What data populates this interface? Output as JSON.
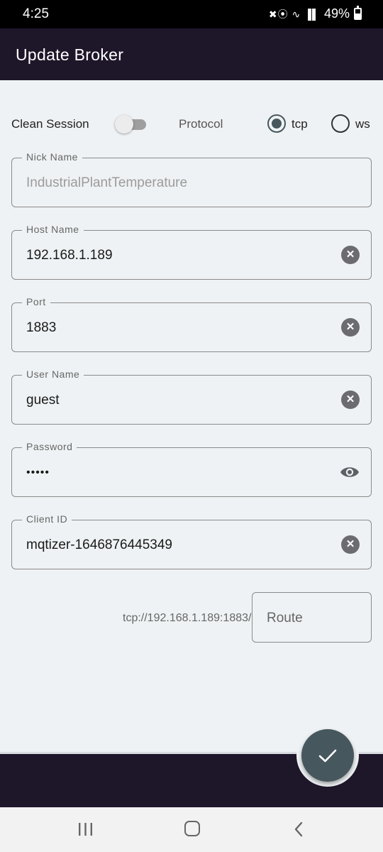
{
  "status_bar": {
    "time": "4:25",
    "battery": "49%",
    "signal_icons": "✖⦿ ∿ ▐▌"
  },
  "app_bar": {
    "title": "Update Broker"
  },
  "options": {
    "clean_session_label": "Clean Session",
    "clean_session_on": false,
    "protocol_label": "Protocol",
    "protocol_options": [
      {
        "label": "tcp",
        "selected": true
      },
      {
        "label": "ws",
        "selected": false
      }
    ]
  },
  "fields": {
    "nick_name": {
      "label": "Nick Name",
      "placeholder": "IndustrialPlantTemperature"
    },
    "host_name": {
      "label": "Host Name",
      "value": "192.168.1.189"
    },
    "port": {
      "label": "Port",
      "value": "1883"
    },
    "user_name": {
      "label": "User Name",
      "value": "guest"
    },
    "password": {
      "label": "Password",
      "value": "•••••"
    },
    "client_id": {
      "label": "Client ID",
      "value": "mqtizer-1646876445349"
    }
  },
  "route": {
    "prefix": "tcp://192.168.1.189:1883/",
    "placeholder": "Route"
  },
  "colors": {
    "app_bar": "#1e1629",
    "accent": "#47575e",
    "background": "#eff2f4"
  },
  "icons": {
    "clear": "clear-icon",
    "visibility": "eye-icon",
    "save": "check-icon",
    "nav_recent": "recent-apps-icon",
    "nav_home": "home-icon",
    "nav_back": "back-icon"
  }
}
